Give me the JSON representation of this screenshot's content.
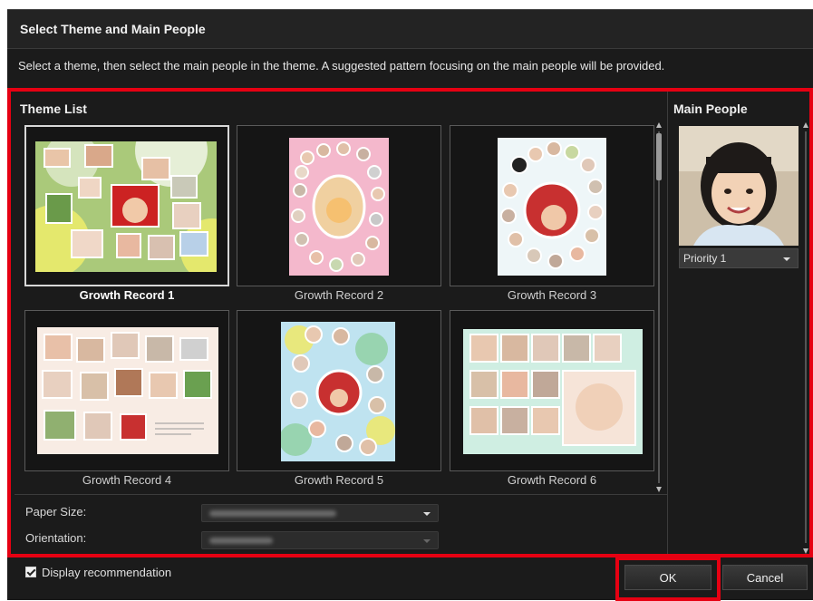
{
  "dialog": {
    "title": "Select Theme and Main People",
    "instruction": "Select a theme, then select the main people in the theme. A suggested pattern focusing on the main people will be provided."
  },
  "theme_list": {
    "heading": "Theme List",
    "themes": [
      {
        "label": "Growth Record 1",
        "selected": true,
        "thumbnail": "green-yellow-photo-collage"
      },
      {
        "label": "Growth Record 2",
        "selected": false,
        "thumbnail": "pink-circle-collage"
      },
      {
        "label": "Growth Record 3",
        "selected": false,
        "thumbnail": "white-circle-ring-collage"
      },
      {
        "label": "Growth Record 4",
        "selected": false,
        "thumbnail": "scattered-polaroid-collage"
      },
      {
        "label": "Growth Record 5",
        "selected": false,
        "thumbnail": "blue-bubble-collage"
      },
      {
        "label": "Growth Record 6",
        "selected": false,
        "thumbnail": "mint-grid-collage"
      }
    ]
  },
  "settings": {
    "paper_size_label": "Paper Size:",
    "orientation_label": "Orientation:"
  },
  "main_people": {
    "heading": "Main People",
    "priority_value": "Priority 1"
  },
  "footer": {
    "display_recommendation_label": "Display recommendation",
    "display_recommendation_checked": true,
    "ok_label": "OK",
    "cancel_label": "Cancel"
  },
  "colors": {
    "highlight": "#e60012",
    "background": "#1b1b1b"
  }
}
